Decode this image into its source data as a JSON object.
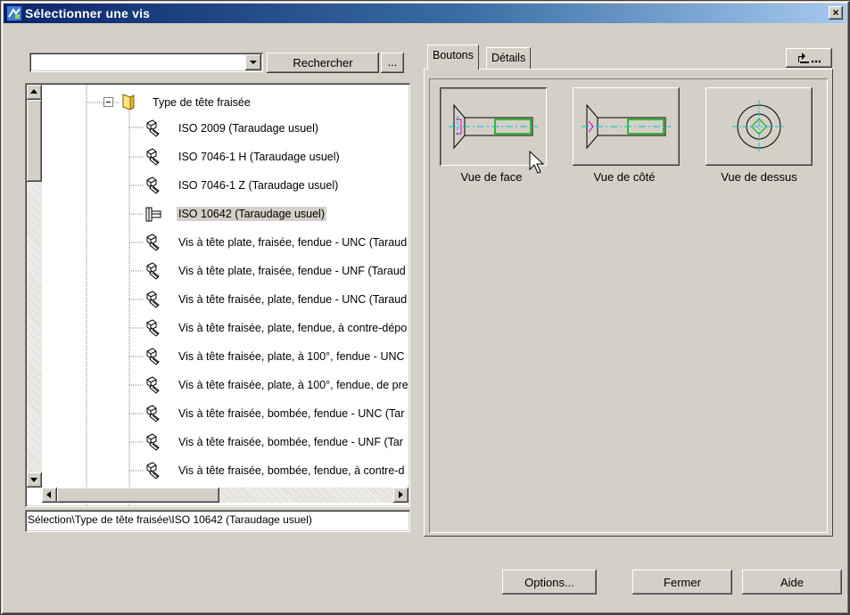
{
  "window": {
    "title": "Sélectionner une vis",
    "close_glyph": "×"
  },
  "search": {
    "value": "",
    "button_label": "Rechercher",
    "browse_label": "..."
  },
  "tree": {
    "folder_label": "Type de tête fraisée",
    "items": [
      "ISO 2009  (Taraudage usuel)",
      "ISO 7046-1  H  (Taraudage usuel)",
      "ISO 7046-1  Z  (Taraudage usuel)",
      "ISO 10642  (Taraudage usuel)",
      "Vis à tête plate, fraisée, fendue - UNC (Taraud",
      "Vis à tête plate, fraisée, fendue - UNF (Taraud",
      "Vis à tête fraisée, plate, fendue - UNC (Taraud",
      "Vis à tête fraisée, plate, fendue, à contre-dépo",
      "Vis à tête fraisée, plate, à 100°, fendue - UNC",
      "Vis à tête fraisée, plate, à 100°, fendue, de pre",
      "Vis à tête fraisée, bombée, fendue - UNC (Tar",
      "Vis à tête fraisée, bombée, fendue - UNF (Tar",
      "Vis à tête fraisée, bombée, fendue, à contre-d"
    ],
    "selected_index": 3
  },
  "path": "Sélection\\Type de tête fraisée\\ISO 10642  (Taraudage usuel)",
  "tabs": {
    "buttons": "Boutons",
    "details": "Détails"
  },
  "views": {
    "front": "Vue de face",
    "side": "Vue de côté",
    "top": "Vue de dessus"
  },
  "footer": {
    "options": "Options...",
    "close": "Fermer",
    "help": "Aide"
  },
  "colors": {
    "title_start": "#0a246a",
    "title_end": "#a6caf0",
    "face": "#d4d0c8",
    "axis": "#00c8c8",
    "thread": "#00b000",
    "slot": "#e000e0"
  }
}
